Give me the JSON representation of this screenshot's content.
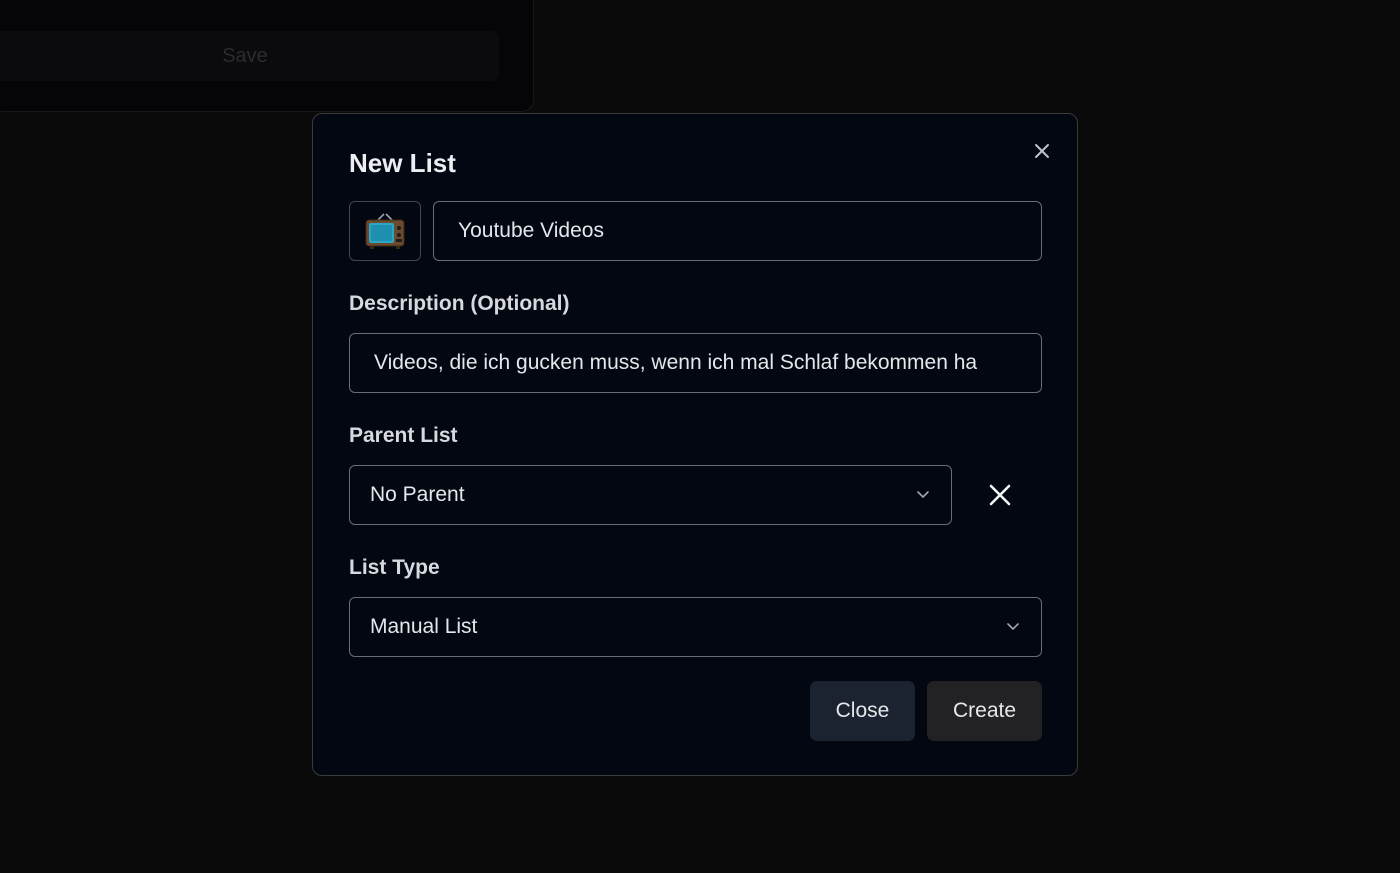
{
  "background": {
    "save_label": "Save"
  },
  "modal": {
    "title": "New List",
    "close_icon": "close-icon",
    "emoji": "📺",
    "name_value": "Youtube Videos",
    "description_label": "Description (Optional)",
    "description_value": "Videos, die ich gucken muss, wenn ich mal Schlaf bekommen ha",
    "parent_label": "Parent List",
    "parent_selected": "No Parent",
    "list_type_label": "List Type",
    "list_type_selected": "Manual List",
    "close_button": "Close",
    "create_button": "Create"
  },
  "colors": {
    "page_bg": "#0a0a0b",
    "modal_bg": "#030711",
    "close_button_bg": "#1b2230",
    "create_button_bg": "#222225"
  }
}
